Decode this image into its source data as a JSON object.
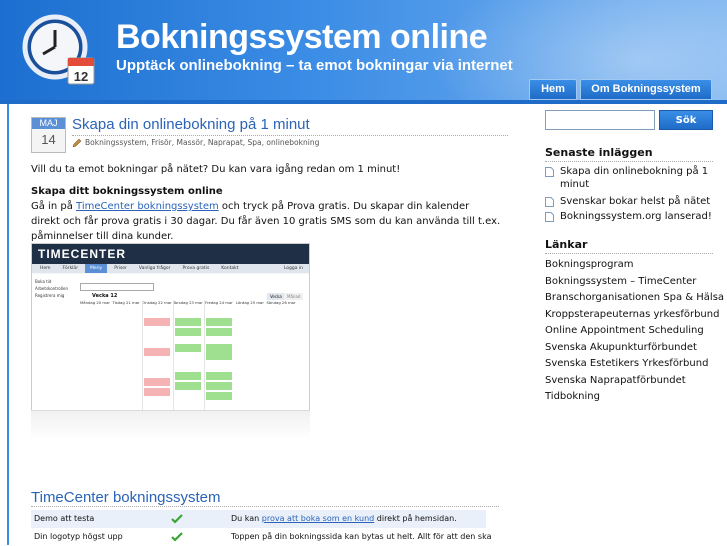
{
  "header": {
    "title": "Bokningssystem online",
    "tagline": "Upptäck onlinebokning – ta emot bokningar via internet",
    "logo_day": "12",
    "nav": [
      "Hem",
      "Om Bokningssystem"
    ]
  },
  "post": {
    "date_month": "MAJ",
    "date_day": "14",
    "title": "Skapa din onlinebokning på 1 minut",
    "meta": "Bokningssystem, Frisör, Massör, Naprapat, Spa, onlinebokning",
    "intro": "Vill du ta emot bokningar på nätet? Du kan vara igång redan om 1 minut!",
    "subheading": "Skapa ditt bokningssystem online",
    "body_pre": "Gå in på ",
    "body_link": "TimeCenter bokningssystem",
    "body_post": " och tryck på Prova gratis. Du skapar din kalender direkt och får prova gratis i 30 dagar. Du får även 10 gratis SMS som du kan använda till t.ex. påminnelser till dina kunder."
  },
  "screenshot": {
    "brand": "TIMECENTER",
    "tabs": [
      "Hem",
      "Förklär",
      "Meny",
      "Priser",
      "Vanliga frågor",
      "Prova gratis",
      "Kontakt"
    ],
    "active_tab": "Meny",
    "logout": "Logga in",
    "side_items": [
      "Boka tid",
      "Arbetskontrollen",
      "Registrera mig"
    ],
    "week_label": "Vecka 12",
    "view_buttons": [
      "Vecka",
      "Månad"
    ],
    "days": [
      "Måndag 20 mar",
      "Tisdag 21 mar",
      "Onsdag 22 mar",
      "Torsdag 23 mar",
      "Fredag 24 mar",
      "Lördag 25 mar",
      "Söndag 26 mar"
    ]
  },
  "section": {
    "title": "TimeCenter bokningssystem",
    "rows": [
      {
        "feature": "Demo att testa",
        "desc_pre": "Du kan ",
        "desc_link": "prova att boka som en kund",
        "desc_post": " direkt på hemsidan."
      },
      {
        "feature": "Din logotyp högst upp",
        "desc_pre": "Toppen på din bokningssida kan bytas ut helt. Allt för att den ska",
        "desc_link": "",
        "desc_post": ""
      }
    ]
  },
  "sidebar": {
    "search_placeholder": "",
    "search_button": "Sök",
    "recent_heading": "Senaste inläggen",
    "recent": [
      "Skapa din onlinebokning på 1 minut",
      "Svenskar bokar helst på nätet",
      "Bokningssystem.org lanserad!"
    ],
    "links_heading": "Länkar",
    "links": [
      "Bokningsprogram",
      "Bokningssystem – TimeCenter",
      "Branschorganisationen Spa & Hälsa",
      "Kroppsterapeuternas yrkesförbund",
      "Online Appointment Scheduling",
      "Svenska Akupunkturförbundet",
      "Svenska Estetikers Yrkesförbund",
      "Svenska Naprapatförbundet",
      "Tidbokning"
    ]
  },
  "colors": {
    "brand_blue": "#1f6cc8",
    "link_blue": "#2a63b8",
    "check_green": "#3aa535"
  }
}
